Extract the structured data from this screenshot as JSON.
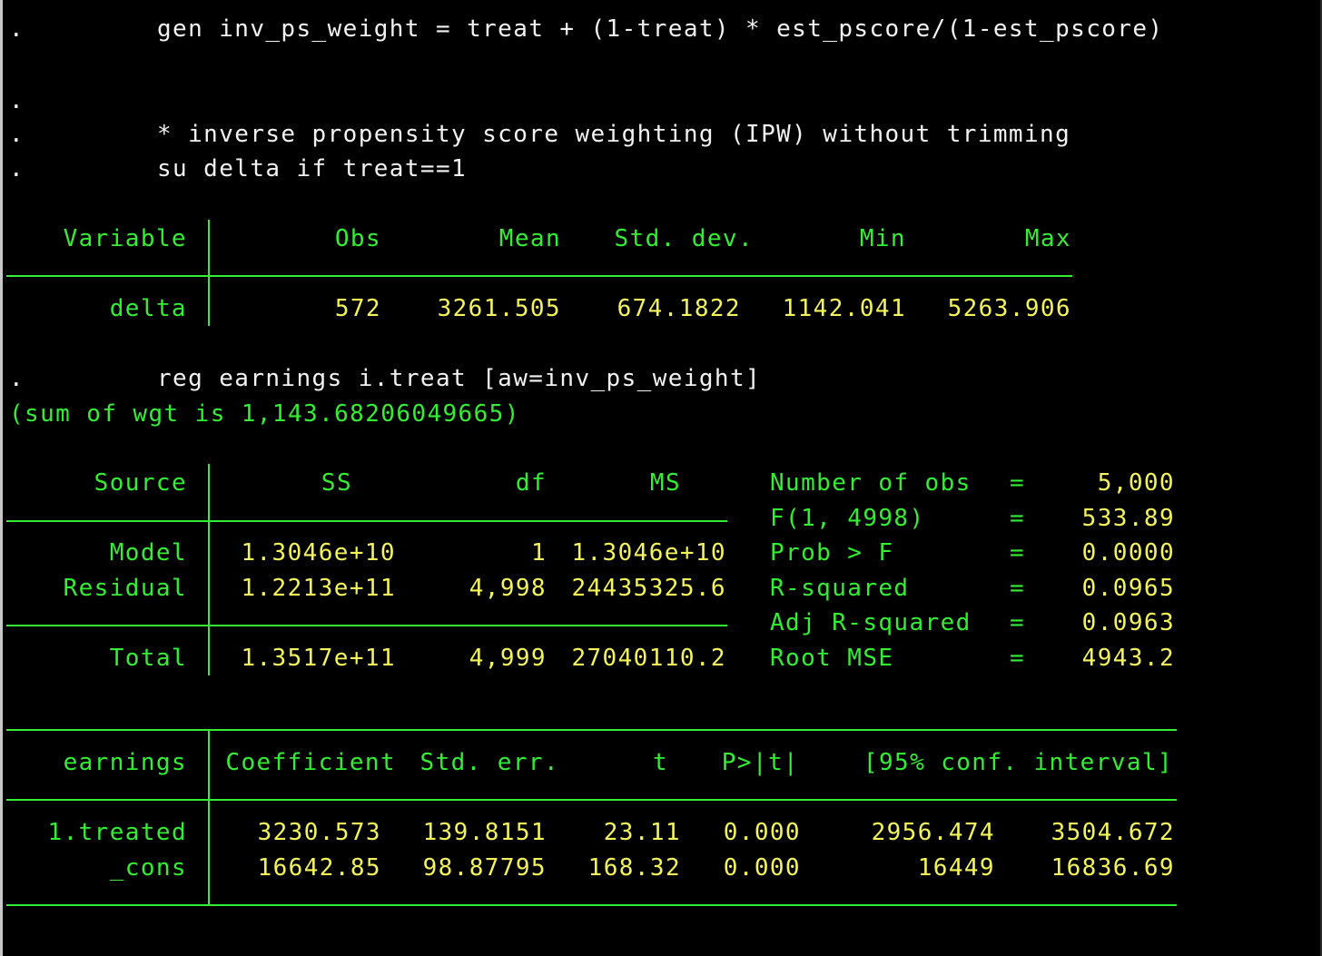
{
  "commands": {
    "c1_prompt": ".",
    "c1": "gen inv_ps_weight = treat + (1-treat) * est_pscore/(1-est_pscore)",
    "c2_prompt": ".",
    "c3_prompt": ".",
    "c3": "* inverse propensity score weighting (IPW) without trimming",
    "c4_prompt": ".",
    "c4": "su delta if treat==1",
    "c5_prompt": ".",
    "c5": "reg earnings i.treat [aw=inv_ps_weight]",
    "sum_note": "(sum of wgt is 1,143.68206049665)"
  },
  "summary": {
    "headers": [
      "Variable",
      "Obs",
      "Mean",
      "Std. dev.",
      "Min",
      "Max"
    ],
    "row": [
      "delta",
      "572",
      "3261.505",
      "674.1822",
      "1142.041",
      "5263.906"
    ]
  },
  "anova": {
    "headers": [
      "Source",
      "SS",
      "df",
      "MS"
    ],
    "rows": [
      [
        "Model",
        "1.3046e+10",
        "1",
        "1.3046e+10"
      ],
      [
        "Residual",
        "1.2213e+11",
        "4,998",
        "24435325.6"
      ]
    ],
    "total": [
      "Total",
      "1.3517e+11",
      "4,999",
      "27040110.2"
    ]
  },
  "stats": [
    {
      "label": "Number of obs",
      "eq": "=",
      "value": "5,000"
    },
    {
      "label": "F(1, 4998)",
      "eq": "=",
      "value": "533.89"
    },
    {
      "label": "Prob > F",
      "eq": "=",
      "value": "0.0000"
    },
    {
      "label": "R-squared",
      "eq": "=",
      "value": "0.0965"
    },
    {
      "label": "Adj R-squared",
      "eq": "=",
      "value": "0.0963"
    },
    {
      "label": "Root MSE",
      "eq": "=",
      "value": "4943.2"
    }
  ],
  "coef": {
    "headers": [
      "earnings",
      "Coefficient",
      "Std. err.",
      "t",
      "P>|t|",
      "[95% conf. interval]"
    ],
    "rows": [
      [
        "1.treated",
        "3230.573",
        "139.8151",
        "23.11",
        "0.000",
        "2956.474",
        "3504.672"
      ],
      [
        "_cons",
        "16642.85",
        "98.87795",
        "168.32",
        "0.000",
        "16449",
        "16836.69"
      ]
    ]
  },
  "colors": {
    "background": "#000000",
    "command_text": "#f2f2f2",
    "label_green": "#33ee33",
    "value_yellow": "#f4f45a"
  }
}
